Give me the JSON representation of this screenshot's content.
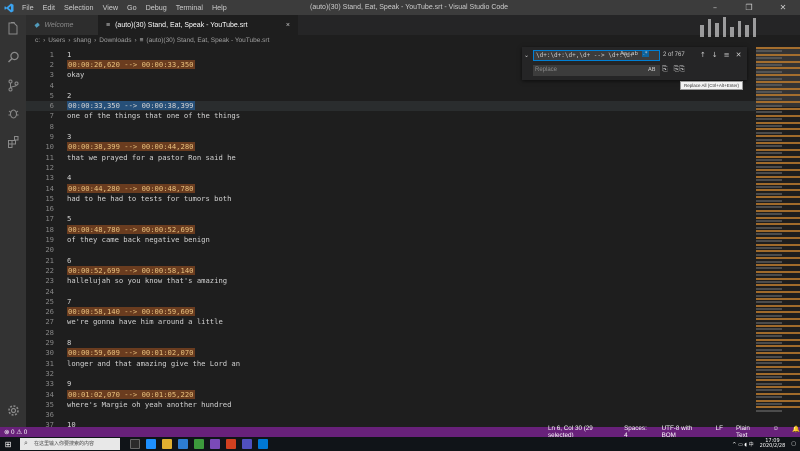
{
  "titlebar": {
    "menu": [
      "File",
      "Edit",
      "Selection",
      "View",
      "Go",
      "Debug",
      "Terminal",
      "Help"
    ],
    "title": "(auto)(30) Stand, Eat, Speak - YouTube.srt - Visual Studio Code",
    "controls": [
      "–",
      "❐",
      "✕"
    ]
  },
  "tabs": [
    {
      "label": "Welcome",
      "icon": "vscode-icon"
    },
    {
      "label": "(auto)(30) Stand, Eat, Speak - YouTube.srt",
      "icon": "file-icon",
      "close": "×"
    }
  ],
  "breadcrumb": [
    "c:",
    "Users",
    "shang",
    "Downloads",
    "(auto)(30) Stand, Eat, Speak - YouTube.srt"
  ],
  "breadcrumb_sep": "›",
  "editor": {
    "lines": [
      {
        "n": "1",
        "text": "1",
        "ts": false
      },
      {
        "n": "2",
        "text": "00:00:26,620 --> 00:00:33,350",
        "ts": true
      },
      {
        "n": "3",
        "text": "okay",
        "ts": false
      },
      {
        "n": "4",
        "text": "",
        "ts": false
      },
      {
        "n": "5",
        "text": "2",
        "ts": false
      },
      {
        "n": "6",
        "text": "00:00:33,350 --> 00:00:38,399",
        "ts": true,
        "current": true
      },
      {
        "n": "7",
        "text": "one of the things that one of the things",
        "ts": false
      },
      {
        "n": "8",
        "text": "",
        "ts": false
      },
      {
        "n": "9",
        "text": "3",
        "ts": false
      },
      {
        "n": "10",
        "text": "00:00:38,399 --> 00:00:44,280",
        "ts": true
      },
      {
        "n": "11",
        "text": "that we prayed for a pastor Ron said he",
        "ts": false
      },
      {
        "n": "12",
        "text": "",
        "ts": false
      },
      {
        "n": "13",
        "text": "4",
        "ts": false
      },
      {
        "n": "14",
        "text": "00:00:44,280 --> 00:00:48,780",
        "ts": true
      },
      {
        "n": "15",
        "text": "had to he had to tests for tumors both",
        "ts": false
      },
      {
        "n": "16",
        "text": "",
        "ts": false
      },
      {
        "n": "17",
        "text": "5",
        "ts": false
      },
      {
        "n": "18",
        "text": "00:00:48,780 --> 00:00:52,699",
        "ts": true
      },
      {
        "n": "19",
        "text": "of they came back negative benign",
        "ts": false
      },
      {
        "n": "20",
        "text": "",
        "ts": false
      },
      {
        "n": "21",
        "text": "6",
        "ts": false
      },
      {
        "n": "22",
        "text": "00:00:52,699 --> 00:00:58,140",
        "ts": true
      },
      {
        "n": "23",
        "text": "hallelujah so you know that's amazing",
        "ts": false
      },
      {
        "n": "24",
        "text": "",
        "ts": false
      },
      {
        "n": "25",
        "text": "7",
        "ts": false
      },
      {
        "n": "26",
        "text": "00:00:58,140 --> 00:00:59,609",
        "ts": true
      },
      {
        "n": "27",
        "text": "we're gonna have him around a little",
        "ts": false
      },
      {
        "n": "28",
        "text": "",
        "ts": false
      },
      {
        "n": "29",
        "text": "8",
        "ts": false
      },
      {
        "n": "30",
        "text": "00:00:59,609 --> 00:01:02,070",
        "ts": true
      },
      {
        "n": "31",
        "text": "longer and that amazing give the Lord an",
        "ts": false
      },
      {
        "n": "32",
        "text": "",
        "ts": false
      },
      {
        "n": "33",
        "text": "9",
        "ts": false
      },
      {
        "n": "34",
        "text": "00:01:02,070 --> 00:01:05,220",
        "ts": true
      },
      {
        "n": "35",
        "text": "where's Margie oh yeah another hundred",
        "ts": false
      },
      {
        "n": "36",
        "text": "",
        "ts": false
      },
      {
        "n": "37",
        "text": "10",
        "ts": false
      }
    ]
  },
  "find": {
    "query": "\\d+:\\d+:\\d+,\\d+ --> \\d+:\\d+",
    "options": [
      "Aa",
      "ab",
      ".*"
    ],
    "count": "2 of 767",
    "nav": [
      "↑",
      "↓",
      "≡",
      "✕"
    ],
    "replace_placeholder": "Replace",
    "replace_ab": "AB",
    "replace_buttons": [
      "⎘",
      "⎘⎘"
    ],
    "tooltip": "Replace All (Ctrl+Alt+Enter)"
  },
  "statusbar": {
    "errors": "0",
    "warnings": "0",
    "error_icon": "⊗",
    "warning_icon": "⚠",
    "position": "Ln 6, Col 30 (29 selected)",
    "spaces": "Spaces: 4",
    "encoding": "UTF-8 with BOM",
    "eol": "LF",
    "language": "Plain Text",
    "feedback_icon": "☺",
    "bell_icon": "🔔"
  },
  "taskbar": {
    "search_placeholder": "在这里输入你要搜索的内容",
    "time": "17:09",
    "date": "2020/2/28"
  }
}
